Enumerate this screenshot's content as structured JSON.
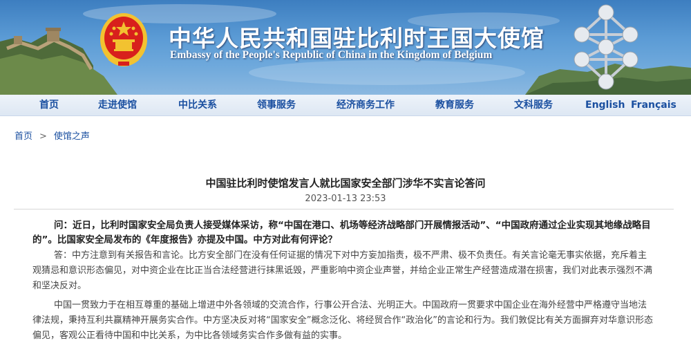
{
  "header": {
    "title_cn": "中华人民共和国驻比利时王国大使馆",
    "title_en": "Embassy of the People's Republic of China in the Kingdom of Belgium",
    "colors": {
      "banner_sky": "#5b9bd5",
      "nav_text": "#1a4fa0",
      "emblem_red": "#d8201c",
      "emblem_gold": "#f2c230"
    }
  },
  "nav": {
    "items": [
      "首页",
      "走进使馆",
      "中比关系",
      "领事服务",
      "经济商务工作",
      "教育服务",
      "文科服务",
      "English",
      "Français"
    ]
  },
  "breadcrumb": {
    "home": "首页",
    "separator": ">",
    "current": "使馆之声"
  },
  "article": {
    "title": "中国驻比利时使馆发言人就比国家安全部门涉华不实言论答问",
    "date": "2023-01-13 23:53",
    "question": "问：近日，比利时国家安全局负责人接受媒体采访，称“中国在港口、机场等经济战略部门开展情报活动”、“中国政府通过企业实现其地缘战略目的”。比国家安全局发布的《年度报告》亦提及中国。中方对此有何评论？",
    "answer_1": "答：中方注意到有关报告和言论。比方安全部门在没有任何证据的情况下对中方妄加指责，极不严肃、极不负责任。有关言论毫无事实依据，充斥着主观猜忌和意识形态偏见，对中资企业在比正当合法经营进行抹黑诋毁，严重影响中资企业声誉，并给企业正常生产经营造成潜在损害，我们对此表示强烈不满和坚决反对。",
    "answer_2": "中国一贯致力于在相互尊重的基础上增进中外各领域的交流合作，行事公开合法、光明正大。中国政府一贯要求中国企业在海外经营中严格遵守当地法律法规，秉持互利共赢精神开展务实合作。中方坚决反对将“国家安全”概念泛化、将经贸合作“政治化”的言论和行为。我们敦促比有关方面摒弃对华意识形态偏见，客观公正看待中国和中比关系，为中比各领域务实合作多做有益的实事。"
  }
}
